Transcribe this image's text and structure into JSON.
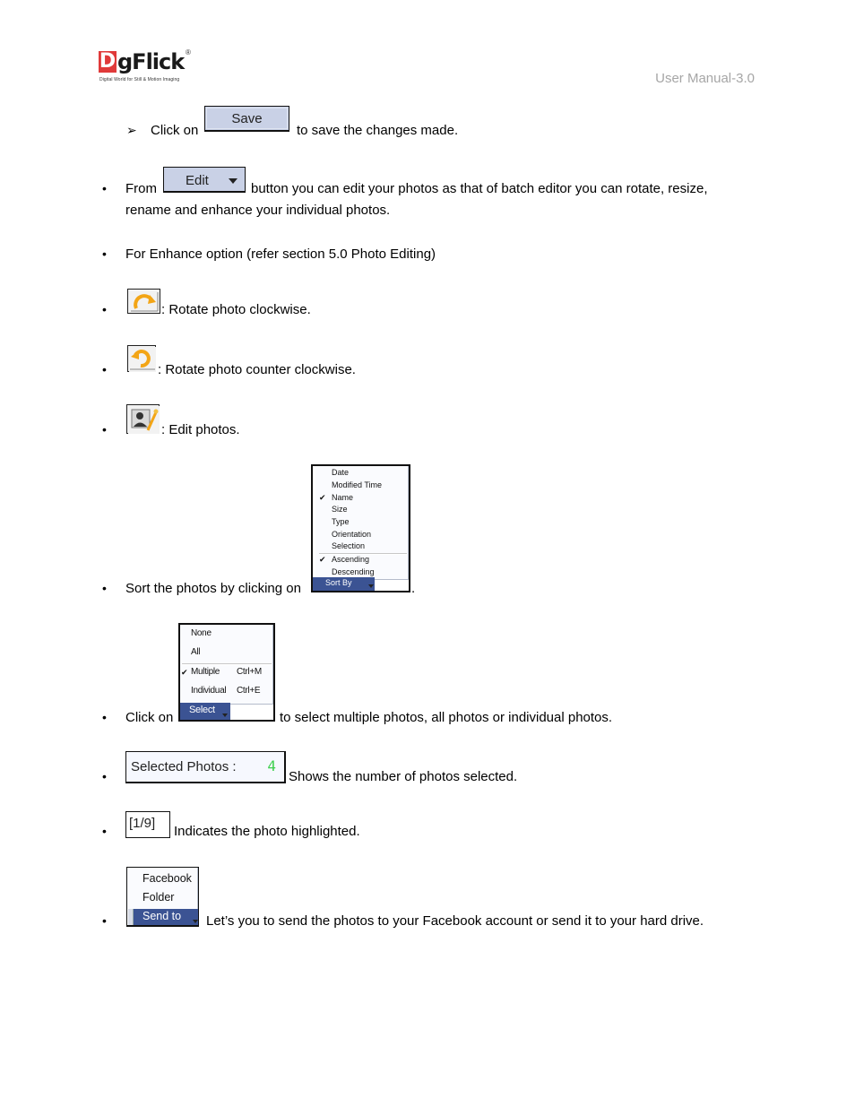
{
  "header": {
    "logo_letter": "D",
    "logo_rest": "gFlick",
    "logo_registered": "®",
    "logo_tagline": "Digital World for Still & Motion Imaging",
    "manual_label": "User Manual-3.0"
  },
  "items": {
    "save": {
      "prefix": "Click on",
      "button_label": "Save",
      "suffix": "to save the changes made."
    },
    "edit": {
      "prefix": "From",
      "button_label": "Edit",
      "suffix_line1": "button you can edit your photos as that of batch editor you can rotate, resize,",
      "line2": "rename and enhance your individual photos."
    },
    "enhance": {
      "text": "For Enhance option (refer section 5.0 Photo Editing)"
    },
    "rotate_cw": {
      "text": ": Rotate photo clockwise."
    },
    "rotate_ccw": {
      "text": ": Rotate photo counter clockwise."
    },
    "edit_photos": {
      "text": ": Edit photos."
    },
    "sort": {
      "prefix": "Sort the photos by clicking on",
      "suffix": ".",
      "button_label": "Sort By",
      "options": [
        {
          "label": "Date",
          "checked": false
        },
        {
          "label": "Modified Time",
          "checked": false
        },
        {
          "label": "Name",
          "checked": true
        },
        {
          "label": "Size",
          "checked": false
        },
        {
          "label": "Type",
          "checked": false
        },
        {
          "label": "Orientation",
          "checked": false
        },
        {
          "label": "Selection",
          "checked": false
        }
      ],
      "order_options": [
        {
          "label": "Ascending",
          "checked": true
        },
        {
          "label": "Descending",
          "checked": false
        }
      ],
      "check_glyph": "✔"
    },
    "select": {
      "prefix": "Click on",
      "suffix": "to select multiple photos, all photos or individual photos.",
      "button_label": "Select",
      "options": [
        {
          "label": "None",
          "shortcut": ""
        },
        {
          "label": "All",
          "shortcut": ""
        }
      ],
      "mode_options": [
        {
          "label": "Multiple",
          "shortcut": "Ctrl+M",
          "checked": true
        },
        {
          "label": "Individual",
          "shortcut": "Ctrl+E",
          "checked": false
        }
      ],
      "check_glyph": "✔"
    },
    "selected_photos": {
      "label": "Selected Photos :",
      "count": "4",
      "suffix": "Shows the number of photos selected."
    },
    "index": {
      "label": "[1/9]",
      "suffix": "Indicates the photo highlighted."
    },
    "send_to": {
      "button_label": "Send to",
      "options": [
        "Facebook",
        "Folder"
      ],
      "suffix": "Let’s you to send the photos to your Facebook account or send it to your hard drive."
    }
  },
  "bullet_glyph": "•",
  "arrow_glyph": "➢",
  "colors": {
    "menu_button_blue": "#3b5393",
    "button_face": "#c9d1e6",
    "count_green": "#3ecf4e",
    "header_gray": "#a6a6a6",
    "logo_red": "#e03a3a",
    "icon_orange": "#f3a516"
  }
}
